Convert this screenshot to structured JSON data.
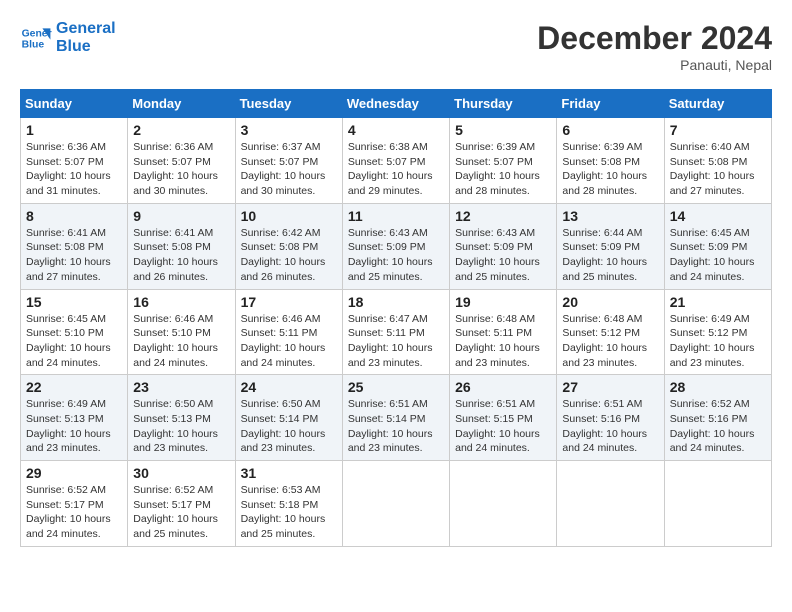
{
  "header": {
    "logo_line1": "General",
    "logo_line2": "Blue",
    "month_title": "December 2024",
    "location": "Panauti, Nepal"
  },
  "weekdays": [
    "Sunday",
    "Monday",
    "Tuesday",
    "Wednesday",
    "Thursday",
    "Friday",
    "Saturday"
  ],
  "weeks": [
    [
      {
        "day": "1",
        "info": "Sunrise: 6:36 AM\nSunset: 5:07 PM\nDaylight: 10 hours\nand 31 minutes."
      },
      {
        "day": "2",
        "info": "Sunrise: 6:36 AM\nSunset: 5:07 PM\nDaylight: 10 hours\nand 30 minutes."
      },
      {
        "day": "3",
        "info": "Sunrise: 6:37 AM\nSunset: 5:07 PM\nDaylight: 10 hours\nand 30 minutes."
      },
      {
        "day": "4",
        "info": "Sunrise: 6:38 AM\nSunset: 5:07 PM\nDaylight: 10 hours\nand 29 minutes."
      },
      {
        "day": "5",
        "info": "Sunrise: 6:39 AM\nSunset: 5:07 PM\nDaylight: 10 hours\nand 28 minutes."
      },
      {
        "day": "6",
        "info": "Sunrise: 6:39 AM\nSunset: 5:08 PM\nDaylight: 10 hours\nand 28 minutes."
      },
      {
        "day": "7",
        "info": "Sunrise: 6:40 AM\nSunset: 5:08 PM\nDaylight: 10 hours\nand 27 minutes."
      }
    ],
    [
      {
        "day": "8",
        "info": "Sunrise: 6:41 AM\nSunset: 5:08 PM\nDaylight: 10 hours\nand 27 minutes."
      },
      {
        "day": "9",
        "info": "Sunrise: 6:41 AM\nSunset: 5:08 PM\nDaylight: 10 hours\nand 26 minutes."
      },
      {
        "day": "10",
        "info": "Sunrise: 6:42 AM\nSunset: 5:08 PM\nDaylight: 10 hours\nand 26 minutes."
      },
      {
        "day": "11",
        "info": "Sunrise: 6:43 AM\nSunset: 5:09 PM\nDaylight: 10 hours\nand 25 minutes."
      },
      {
        "day": "12",
        "info": "Sunrise: 6:43 AM\nSunset: 5:09 PM\nDaylight: 10 hours\nand 25 minutes."
      },
      {
        "day": "13",
        "info": "Sunrise: 6:44 AM\nSunset: 5:09 PM\nDaylight: 10 hours\nand 25 minutes."
      },
      {
        "day": "14",
        "info": "Sunrise: 6:45 AM\nSunset: 5:09 PM\nDaylight: 10 hours\nand 24 minutes."
      }
    ],
    [
      {
        "day": "15",
        "info": "Sunrise: 6:45 AM\nSunset: 5:10 PM\nDaylight: 10 hours\nand 24 minutes."
      },
      {
        "day": "16",
        "info": "Sunrise: 6:46 AM\nSunset: 5:10 PM\nDaylight: 10 hours\nand 24 minutes."
      },
      {
        "day": "17",
        "info": "Sunrise: 6:46 AM\nSunset: 5:11 PM\nDaylight: 10 hours\nand 24 minutes."
      },
      {
        "day": "18",
        "info": "Sunrise: 6:47 AM\nSunset: 5:11 PM\nDaylight: 10 hours\nand 23 minutes."
      },
      {
        "day": "19",
        "info": "Sunrise: 6:48 AM\nSunset: 5:11 PM\nDaylight: 10 hours\nand 23 minutes."
      },
      {
        "day": "20",
        "info": "Sunrise: 6:48 AM\nSunset: 5:12 PM\nDaylight: 10 hours\nand 23 minutes."
      },
      {
        "day": "21",
        "info": "Sunrise: 6:49 AM\nSunset: 5:12 PM\nDaylight: 10 hours\nand 23 minutes."
      }
    ],
    [
      {
        "day": "22",
        "info": "Sunrise: 6:49 AM\nSunset: 5:13 PM\nDaylight: 10 hours\nand 23 minutes."
      },
      {
        "day": "23",
        "info": "Sunrise: 6:50 AM\nSunset: 5:13 PM\nDaylight: 10 hours\nand 23 minutes."
      },
      {
        "day": "24",
        "info": "Sunrise: 6:50 AM\nSunset: 5:14 PM\nDaylight: 10 hours\nand 23 minutes."
      },
      {
        "day": "25",
        "info": "Sunrise: 6:51 AM\nSunset: 5:14 PM\nDaylight: 10 hours\nand 23 minutes."
      },
      {
        "day": "26",
        "info": "Sunrise: 6:51 AM\nSunset: 5:15 PM\nDaylight: 10 hours\nand 24 minutes."
      },
      {
        "day": "27",
        "info": "Sunrise: 6:51 AM\nSunset: 5:16 PM\nDaylight: 10 hours\nand 24 minutes."
      },
      {
        "day": "28",
        "info": "Sunrise: 6:52 AM\nSunset: 5:16 PM\nDaylight: 10 hours\nand 24 minutes."
      }
    ],
    [
      {
        "day": "29",
        "info": "Sunrise: 6:52 AM\nSunset: 5:17 PM\nDaylight: 10 hours\nand 24 minutes."
      },
      {
        "day": "30",
        "info": "Sunrise: 6:52 AM\nSunset: 5:17 PM\nDaylight: 10 hours\nand 25 minutes."
      },
      {
        "day": "31",
        "info": "Sunrise: 6:53 AM\nSunset: 5:18 PM\nDaylight: 10 hours\nand 25 minutes."
      },
      {
        "day": "",
        "info": ""
      },
      {
        "day": "",
        "info": ""
      },
      {
        "day": "",
        "info": ""
      },
      {
        "day": "",
        "info": ""
      }
    ]
  ]
}
